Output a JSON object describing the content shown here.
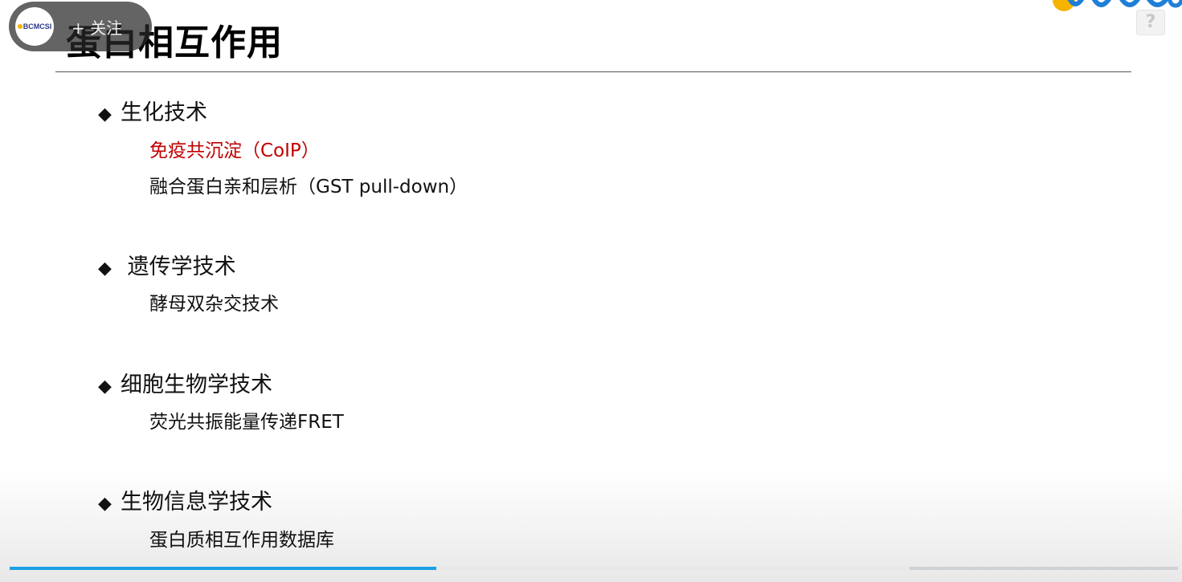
{
  "slide": {
    "title": "蛋白相互作用",
    "sections": [
      {
        "heading": "生化技术",
        "items": [
          {
            "text": "免疫共沉淀（CoIP）",
            "color": "#c00000"
          },
          {
            "text": "融合蛋白亲和层析（GST pull-down）",
            "color": "#111111"
          }
        ]
      },
      {
        "heading": " 遗传学技术",
        "items": [
          {
            "text": "酵母双杂交技术",
            "color": "#111111"
          }
        ]
      },
      {
        "heading": "细胞生物学技术",
        "items": [
          {
            "text": "荧光共振能量传递FRET",
            "color": "#111111"
          }
        ]
      },
      {
        "heading": "生物信息学技术",
        "items": [
          {
            "text": "蛋白质相互作用数据库",
            "color": "#111111"
          }
        ]
      }
    ],
    "bullet_glyph": "◆"
  },
  "overlay": {
    "follow_label": "+ 关注",
    "avatar_text": "BCMCSI",
    "help_glyph": "?"
  },
  "player": {
    "progress_played": 0.365,
    "accent_color": "#1aa0e6"
  }
}
